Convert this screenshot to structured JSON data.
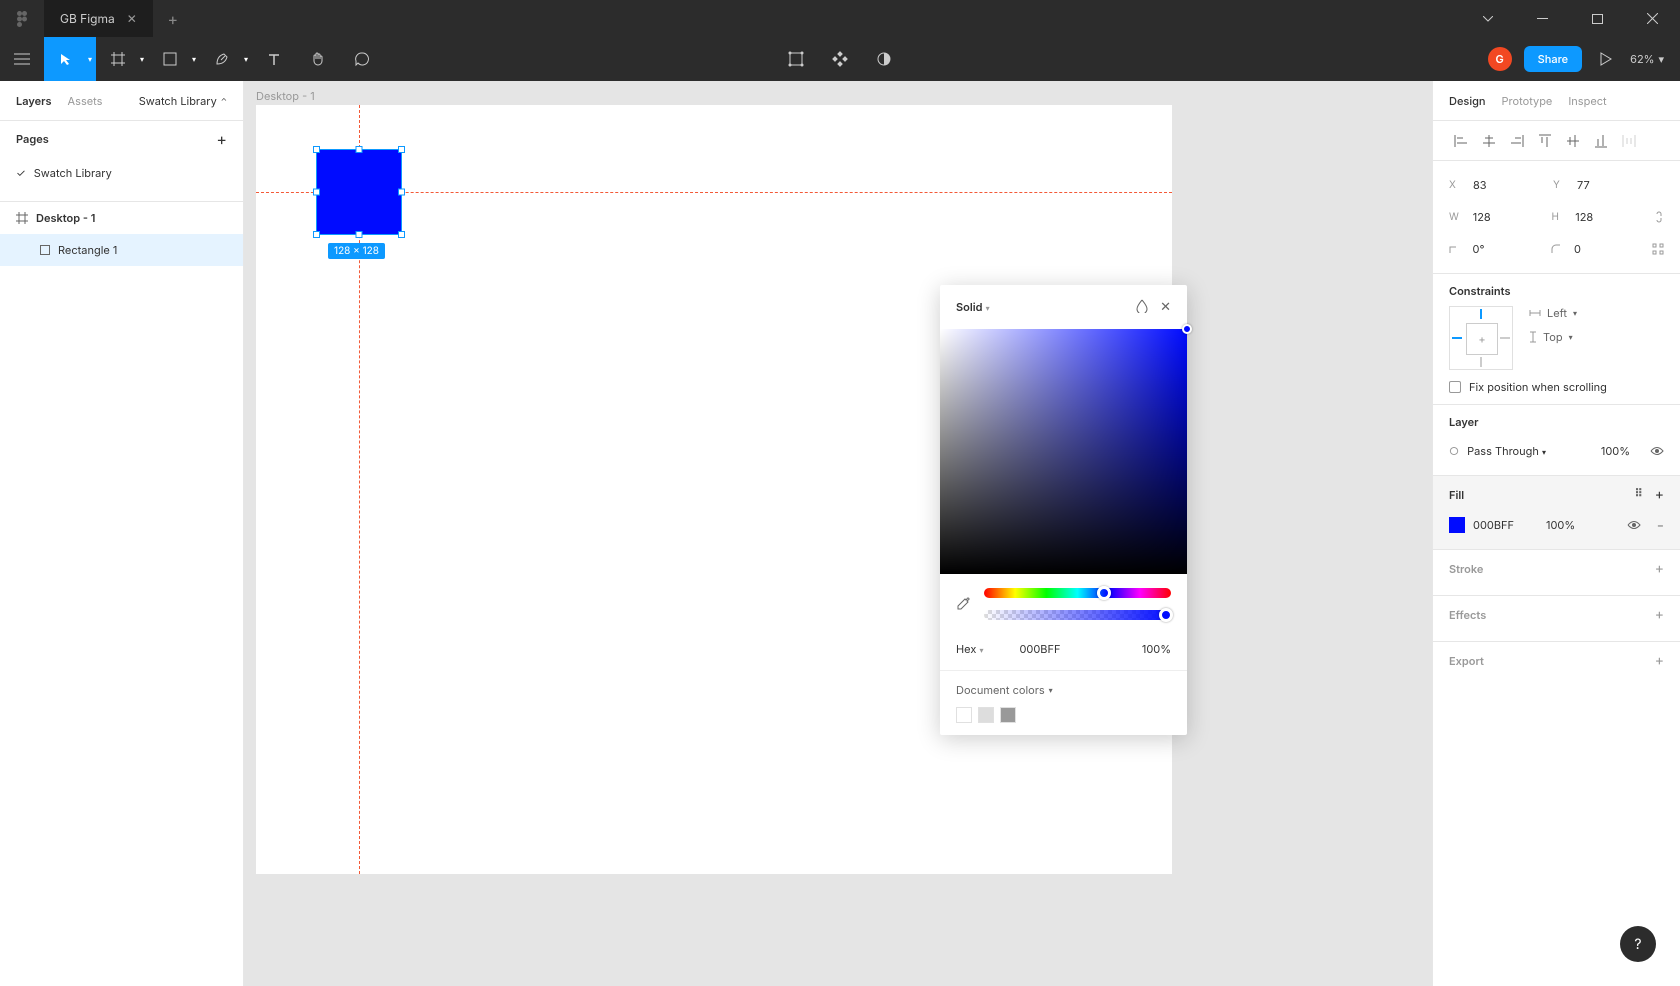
{
  "titlebar": {
    "tab_name": "GB Figma",
    "add_tab": "+"
  },
  "toolbar": {
    "avatar": "G",
    "share": "Share",
    "zoom": "62%"
  },
  "left_panel": {
    "tabs": {
      "layers": "Layers",
      "assets": "Assets",
      "project": "Swatch Library"
    },
    "pages_label": "Pages",
    "page": "Swatch Library",
    "frame": "Desktop - 1",
    "layer": "Rectangle 1"
  },
  "canvas": {
    "frame_label": "Desktop - 1",
    "dim_badge": "128 × 128"
  },
  "right_panel": {
    "tabs": {
      "design": "Design",
      "prototype": "Prototype",
      "inspect": "Inspect"
    },
    "x_label": "X",
    "x": "83",
    "y_label": "Y",
    "y": "77",
    "w_label": "W",
    "w": "128",
    "h_label": "H",
    "h": "128",
    "rot": "0°",
    "radius": "0",
    "constraints": "Constraints",
    "c_left": "Left",
    "c_top": "Top",
    "fix_pos": "Fix position when scrolling",
    "layer": "Layer",
    "blend": "Pass Through",
    "layer_opacity": "100%",
    "fill": "Fill",
    "fill_hex": "000BFF",
    "fill_opacity": "100%",
    "stroke": "Stroke",
    "effects": "Effects",
    "export": "Export"
  },
  "color_picker": {
    "mode": "Solid",
    "hex_label": "Hex",
    "hex": "000BFF",
    "opacity": "100%",
    "doc_colors": "Document colors"
  }
}
